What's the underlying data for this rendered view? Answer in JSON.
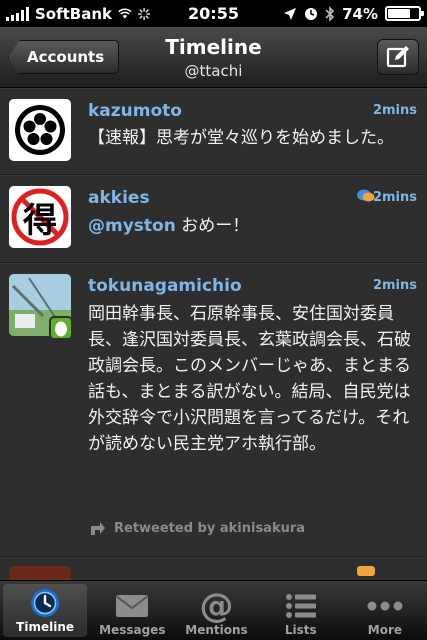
{
  "status_bar": {
    "carrier": "SoftBank",
    "time": "20:55",
    "battery": "74%",
    "battery_level": 0.74
  },
  "nav": {
    "back_label": "Accounts",
    "title": "Timeline",
    "subtitle": "@ttachi"
  },
  "tweets": [
    {
      "user": "kazumoto",
      "time": "2mins",
      "text": "【速報】思考が堂々巡りを始めました。"
    },
    {
      "user": "akkies",
      "time": "2mins",
      "mention": "@myston",
      "text": " おめー！",
      "avatar_char": "得"
    },
    {
      "user": "tokunagamichio",
      "time": "2mins",
      "text": "岡田幹事長、石原幹事長、安住国対委員長、逢沢国対委員長、玄葉政調会長、石破政調会長。このメンバーじゃあ、まとまる話も、まとまる訳がない。結局、自民党は外交辞令で小沢問題を言ってるだけ。それが読めない民主党アホ執行部。",
      "retweet": "Retweeted by akinisakura"
    }
  ],
  "tabs": [
    {
      "label": "Timeline",
      "icon": "clock-icon"
    },
    {
      "label": "Messages",
      "icon": "envelope-icon"
    },
    {
      "label": "Mentions",
      "icon": "at-icon"
    },
    {
      "label": "Lists",
      "icon": "list-icon"
    },
    {
      "label": "More",
      "icon": "more-icon"
    }
  ],
  "colors": {
    "link": "#7fb6e8",
    "accent_blue": "#2f8fe8"
  }
}
